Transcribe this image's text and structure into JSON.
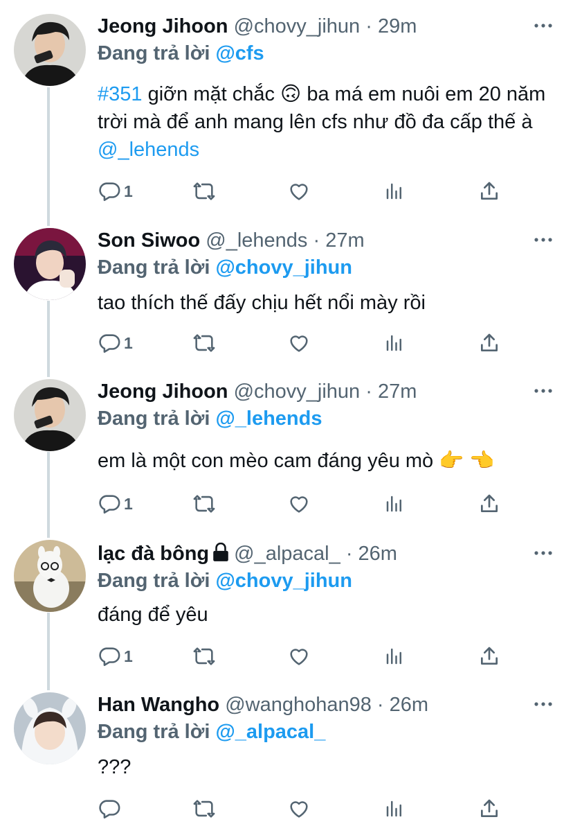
{
  "reply_prefix": "Đang trả lời",
  "tweets": [
    {
      "name": "Jeong Jihoon",
      "handle": "@chovy_jihun",
      "time": "· 29m",
      "reply_to": "@cfs",
      "text": {
        "hashtag": "#351",
        "body1": " giỡn mặt chắc 🙃  ba má em nuôi em 20 năm trời mà để anh mang lên cfs như đồ đa cấp thế à ",
        "mention": "@_lehends"
      },
      "reply_count": "1",
      "avatar": "avatar-jihoon"
    },
    {
      "name": "Son Siwoo",
      "handle": "@_lehends",
      "time": "· 27m",
      "reply_to": "@chovy_jihun",
      "text": "tao thích thế đấy chịu hết nổi mày rồi",
      "reply_count": "1",
      "avatar": "avatar-siwoo"
    },
    {
      "name": "Jeong Jihoon",
      "handle": "@chovy_jihun",
      "time": "· 27m",
      "reply_to": "@_lehends",
      "text": "em là một con mèo cam đáng yêu mò 👉 👈",
      "reply_count": "1",
      "avatar": "avatar-jihoon"
    },
    {
      "name": "lạc đà bông",
      "locked": true,
      "handle": "@_alpacal_",
      "time": "· 26m",
      "reply_to": "@chovy_jihun",
      "text": "đáng để yêu",
      "reply_count": "1",
      "avatar": "avatar-alpaca"
    },
    {
      "name": "Han Wangho",
      "handle": "@wanghohan98",
      "time": "· 26m",
      "reply_to": "@_alpacal_",
      "text": "???",
      "reply_count": "",
      "avatar": "avatar-wangho"
    }
  ],
  "icons": [
    "reply-icon",
    "retweet-icon",
    "like-icon",
    "analytics-icon",
    "share-icon",
    "more-icon",
    "lock-icon"
  ],
  "colors": {
    "link": "#1d9bf0",
    "meta": "#536471",
    "text": "#0f1419",
    "thread": "#cfd9de"
  }
}
